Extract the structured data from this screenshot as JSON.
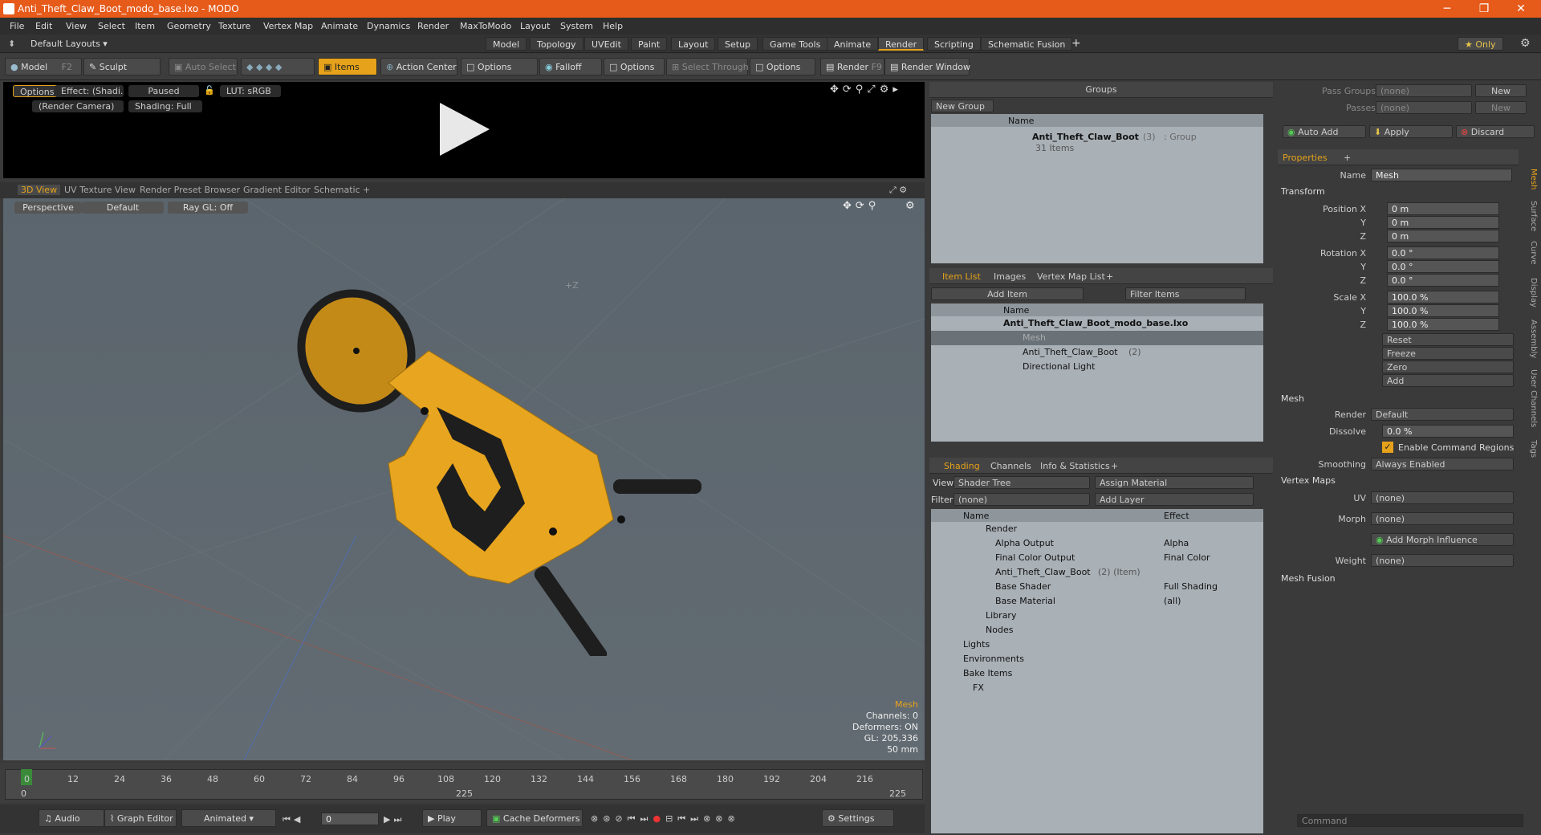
{
  "window": {
    "title": "Anti_Theft_Claw_Boot_modo_base.lxo - MODO",
    "minimize": "─",
    "maximize": "❐",
    "close": "✕"
  },
  "menu": [
    "File",
    "Edit",
    "View",
    "Select",
    "Item",
    "Geometry",
    "Texture",
    "Vertex Map",
    "Animate",
    "Dynamics",
    "Render",
    "MaxToModo",
    "Layout",
    "System",
    "Help"
  ],
  "layout": {
    "preset": "Default Layouts ▾",
    "tabs": [
      "Model",
      "Topology",
      "UVEdit",
      "Paint",
      "Layout",
      "Setup",
      "Game Tools",
      "Animate",
      "Render",
      "Scripting",
      "Schematic Fusion"
    ],
    "active": "Render",
    "add": "+",
    "only": "★ Only"
  },
  "toolbar": {
    "model": "Model",
    "model_key": "F2",
    "sculpt": "Sculpt",
    "auto_select": "Auto Select",
    "items": "Items",
    "action_center": "Action Center",
    "options1": "Options",
    "falloff": "Falloff",
    "options2": "Options",
    "select_through": "Select Through",
    "options3": "Options",
    "render": "Render",
    "render_key": "F9",
    "render_window": "Render Window"
  },
  "render_preview": {
    "options": "Options",
    "effect": "Effect: (Shadi...",
    "paused": "Paused",
    "lut": "LUT: sRGB",
    "camera": "(Render Camera)",
    "shading": "Shading: Full"
  },
  "view_tabs": [
    "3D View",
    "UV Texture View",
    "Render Preset Browser",
    "Gradient Editor",
    "Schematic",
    "+"
  ],
  "viewport": {
    "perspective": "Perspective",
    "default": "Default",
    "raygl": "Ray GL: Off",
    "axis_label": "+Z",
    "info_mesh": "Mesh",
    "info_channels": "Channels: 0",
    "info_deformers": "Deformers: ON",
    "info_gl": "GL: 205,336",
    "info_scale": "50 mm",
    "colors": {
      "body": "#e8a51f",
      "dark": "#1e1e1e"
    }
  },
  "timeline": {
    "ticks": [
      "0",
      "12",
      "24",
      "36",
      "48",
      "60",
      "72",
      "84",
      "96",
      "108",
      "120",
      "132",
      "144",
      "156",
      "168",
      "180",
      "192",
      "204",
      "216"
    ],
    "end1": "225",
    "end2": "225",
    "cur": "0"
  },
  "transport": {
    "audio": "Audio",
    "graph": "Graph Editor",
    "animated": "Animated",
    "frame": "0",
    "play": "Play",
    "cache": "Cache Deformers",
    "settings": "Settings"
  },
  "groups": {
    "title": "Groups",
    "new_group": "New Group",
    "col_name": "Name",
    "item": "Anti_Theft_Claw_Boot",
    "item_count": "(3)",
    "item_type": ": Group",
    "item_sub": "31 Items"
  },
  "item_list": {
    "tabs": [
      "Item List",
      "Images",
      "Vertex Map List",
      "+"
    ],
    "add_item": "Add Item",
    "filter": "Filter Items",
    "col_name": "Name",
    "rows": [
      {
        "label": "Anti_Theft_Claw_Boot_modo_base.lxo",
        "bold": true
      },
      {
        "label": "Mesh",
        "dim": true
      },
      {
        "label": "Anti_Theft_Claw_Boot",
        "count": "(2)"
      },
      {
        "label": "Directional Light"
      }
    ]
  },
  "shading": {
    "tabs": [
      "Shading",
      "Channels",
      "Info & Statistics",
      "+"
    ],
    "view_label": "View",
    "view_value": "Shader Tree",
    "assign": "Assign Material",
    "filter_label": "Filter",
    "filter_value": "(none)",
    "add_layer": "Add Layer",
    "col_name": "Name",
    "col_effect": "Effect",
    "rows": [
      {
        "name": "Render",
        "effect": ""
      },
      {
        "name": "Alpha Output",
        "effect": "Alpha"
      },
      {
        "name": "Final Color Output",
        "effect": "Final Color"
      },
      {
        "name": "Anti_Theft_Claw_Boot",
        "extra": "(2) (Item)",
        "effect": ""
      },
      {
        "name": "Base Shader",
        "effect": "Full Shading"
      },
      {
        "name": "Base Material",
        "effect": "(all)"
      },
      {
        "name": "Library",
        "effect": ""
      },
      {
        "name": "Nodes",
        "effect": ""
      },
      {
        "name": "Lights",
        "effect": ""
      },
      {
        "name": "Environments",
        "effect": ""
      },
      {
        "name": "Bake Items",
        "effect": ""
      },
      {
        "name": "FX",
        "effect": ""
      }
    ]
  },
  "properties": {
    "pass_groups": "Pass Groups",
    "passes": "Passes",
    "none": "(none)",
    "new": "New",
    "auto_add": "Auto Add",
    "apply": "Apply",
    "discard": "Discard",
    "tab": "Properties",
    "tab_add": "+",
    "name_label": "Name",
    "name_value": "Mesh",
    "transform": "Transform",
    "position_x": "Position X",
    "y": "Y",
    "z": "Z",
    "pos": [
      "0 m",
      "0 m",
      "0 m"
    ],
    "rotation_x": "Rotation X",
    "rot": [
      "0.0 °",
      "0.0 °",
      "0.0 °"
    ],
    "scale_x": "Scale X",
    "scl": [
      "100.0 %",
      "100.0 %",
      "100.0 %"
    ],
    "reset": "Reset",
    "freeze": "Freeze",
    "zero": "Zero",
    "add": "Add",
    "mesh": "Mesh",
    "render_label": "Render",
    "render_value": "Default",
    "dissolve_label": "Dissolve",
    "dissolve_value": "0.0 %",
    "enable_cmd": "Enable Command Regions",
    "smoothing_label": "Smoothing",
    "smoothing_value": "Always Enabled",
    "vertex_maps": "Vertex Maps",
    "uv_label": "UV",
    "morph_label": "Morph",
    "add_morph": "Add Morph Influence",
    "weight_label": "Weight",
    "mesh_fusion": "Mesh Fusion",
    "side_tabs": [
      "Mesh",
      "Surface",
      "Curve",
      "Display",
      "Assembly",
      "User Channels",
      "Tags"
    ],
    "command": "Command"
  }
}
